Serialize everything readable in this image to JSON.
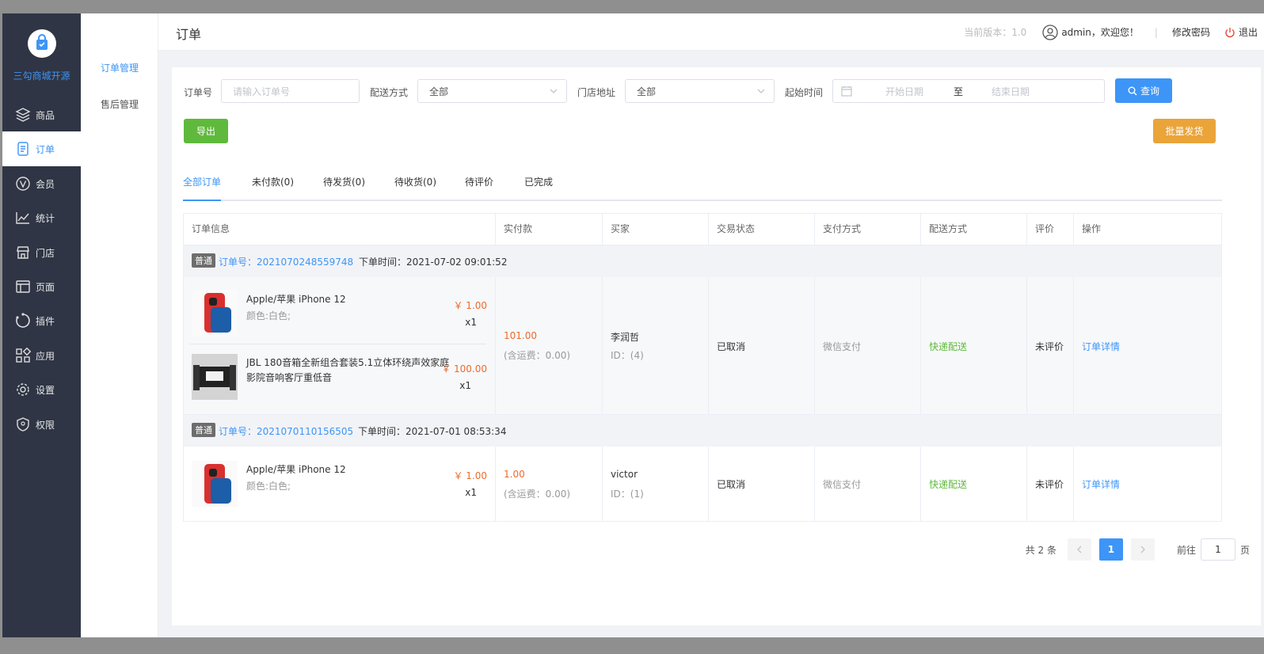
{
  "sidebar": {
    "brand": "三勾商城开源",
    "items": [
      {
        "label": "商品",
        "icon": "layers-icon"
      },
      {
        "label": "订单",
        "icon": "order-icon"
      },
      {
        "label": "会员",
        "icon": "member-icon"
      },
      {
        "label": "统计",
        "icon": "chart-icon"
      },
      {
        "label": "门店",
        "icon": "store-icon"
      },
      {
        "label": "页面",
        "icon": "page-icon"
      },
      {
        "label": "插件",
        "icon": "plugin-icon"
      },
      {
        "label": "应用",
        "icon": "apps-icon"
      },
      {
        "label": "设置",
        "icon": "gear-icon"
      },
      {
        "label": "权限",
        "icon": "shield-icon"
      }
    ]
  },
  "submenu": {
    "items": [
      "订单管理",
      "售后管理"
    ]
  },
  "header": {
    "title": "订单",
    "version": "当前版本：1.0",
    "user": "admin，欢迎您！",
    "separator": "|",
    "change_password": "修改密码",
    "logout": "退出"
  },
  "filters": {
    "order_no_label": "订单号",
    "order_no_placeholder": "请输入订单号",
    "delivery_label": "配送方式",
    "delivery_value": "全部",
    "store_label": "门店地址",
    "store_value": "全部",
    "time_label": "起始时间",
    "start_placeholder": "开始日期",
    "to": "至",
    "end_placeholder": "结束日期",
    "search": "查询",
    "export": "导出",
    "batch_ship": "批量发货"
  },
  "tabs": [
    "全部订单",
    "未付款(0)",
    "待发货(0)",
    "待收货(0)",
    "待评价",
    "已完成"
  ],
  "table": {
    "headers": [
      "订单信息",
      "实付款",
      "买家",
      "交易状态",
      "支付方式",
      "配送方式",
      "评价",
      "操作"
    ],
    "orders": [
      {
        "type": "普通",
        "order_no": "订单号：2021070248559748",
        "time": "下单时间：2021-07-02 09:01:52",
        "products": [
          {
            "name": "Apple/苹果 iPhone 12",
            "spec": "颜色:白色;",
            "price": "￥ 1.00",
            "qty": "x1"
          },
          {
            "name": "JBL 180音箱全新组合套装5.1立体环绕声效家庭影院音响客厅重低音",
            "spec": "",
            "price": "￥ 100.00",
            "qty": "x1"
          }
        ],
        "pay": "101.00",
        "freight": "(含运费：0.00)",
        "buyer": "李润哲",
        "buyer_id": "ID：(4)",
        "status": "已取消",
        "pay_method": "微信支付",
        "delivery": "快递配送",
        "review": "未评价",
        "action": "订单详情"
      },
      {
        "type": "普通",
        "order_no": "订单号：2021070110156505",
        "time": "下单时间：2021-07-01 08:53:34",
        "products": [
          {
            "name": "Apple/苹果 iPhone 12",
            "spec": "颜色:白色;",
            "price": "￥ 1.00",
            "qty": "x1"
          }
        ],
        "pay": "1.00",
        "freight": "(含运费：0.00)",
        "buyer": "victor",
        "buyer_id": "ID：(1)",
        "status": "已取消",
        "pay_method": "微信支付",
        "delivery": "快递配送",
        "review": "未评价",
        "action": "订单详情"
      }
    ]
  },
  "pager": {
    "total": "共 2 条",
    "current": "1",
    "goto_label": "前往",
    "goto_value": "1",
    "page_unit": "页"
  },
  "colors": {
    "primary": "#3d95f7",
    "success": "#5fb93c",
    "warning": "#eaa43a",
    "sidebar": "#2f3545",
    "price": "#ec6a2c"
  }
}
